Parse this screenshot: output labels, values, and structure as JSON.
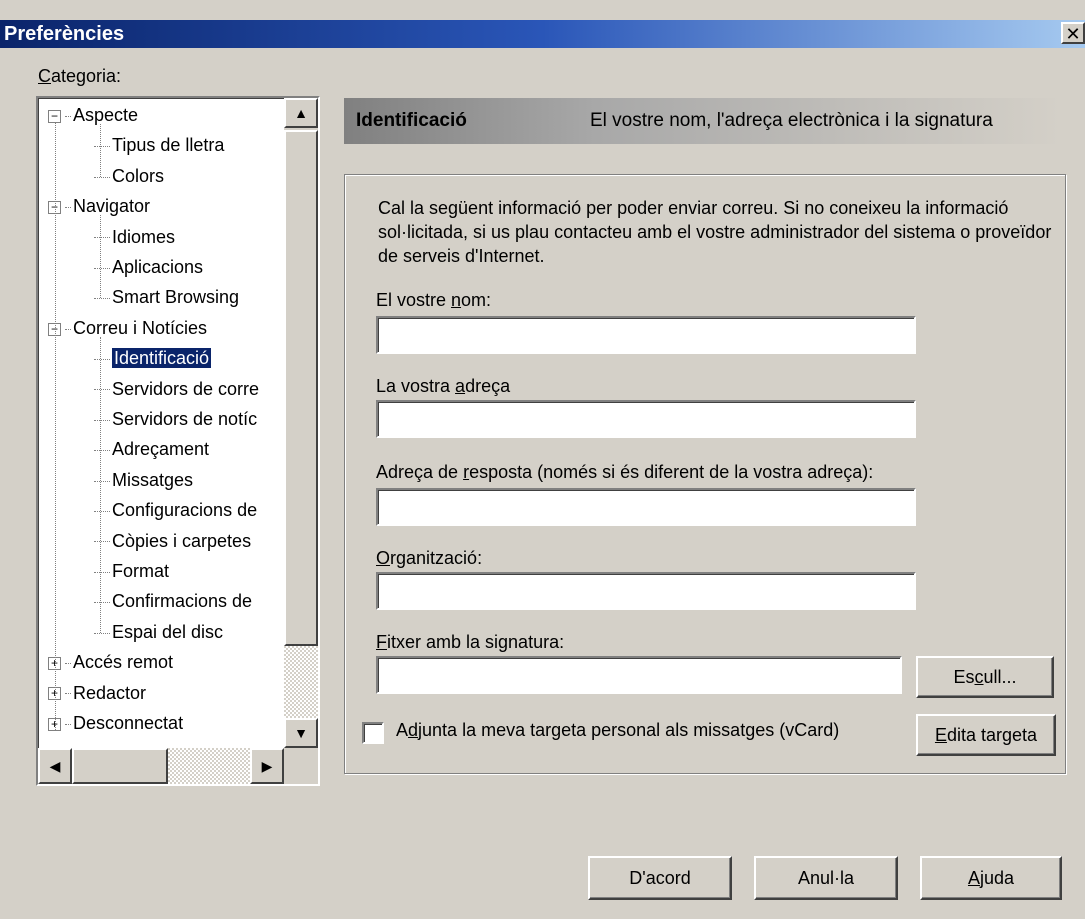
{
  "window": {
    "title": "Preferències",
    "close_glyph": "✕"
  },
  "category": {
    "label_pre": "",
    "label_ul": "C",
    "label_post": "ategoria:"
  },
  "tree": {
    "items": [
      {
        "label": "Aspecte",
        "level": 0,
        "expander": "−"
      },
      {
        "label": "Tipus de lletra",
        "level": 1
      },
      {
        "label": "Colors",
        "level": 1
      },
      {
        "label": "Navigator",
        "level": 0,
        "expander": "−"
      },
      {
        "label": "Idiomes",
        "level": 1
      },
      {
        "label": "Aplicacions",
        "level": 1
      },
      {
        "label": "Smart Browsing",
        "level": 1
      },
      {
        "label": "Correu i Notícies",
        "level": 0,
        "expander": "−"
      },
      {
        "label": "Identificació",
        "level": 1,
        "selected": true
      },
      {
        "label": "Servidors de corre",
        "level": 1
      },
      {
        "label": "Servidors de notíc",
        "level": 1
      },
      {
        "label": "Adreçament",
        "level": 1
      },
      {
        "label": "Missatges",
        "level": 1
      },
      {
        "label": "Configuracions de",
        "level": 1
      },
      {
        "label": "Còpies i carpetes",
        "level": 1
      },
      {
        "label": "Format",
        "level": 1
      },
      {
        "label": "Confirmacions de",
        "level": 1
      },
      {
        "label": "Espai del disc",
        "level": 1
      },
      {
        "label": "Accés remot",
        "level": 0,
        "expander": "+"
      },
      {
        "label": "Redactor",
        "level": 0,
        "expander": "+"
      },
      {
        "label": "Desconnectat",
        "level": 0,
        "expander": "+"
      }
    ]
  },
  "header": {
    "title": "Identificació",
    "description": "El vostre nom, l'adreça electrònica i  la signatura"
  },
  "intro": "Cal la següent informació per poder enviar correu.  Si no coneixeu la informació sol·licitada, si us plau contacteu amb el vostre administrador del sistema o proveïdor de serveis d'Internet.",
  "fields": {
    "name": {
      "pre": "El vostre ",
      "ul": "n",
      "post": "om:",
      "value": ""
    },
    "address": {
      "pre": "La vostra ",
      "ul": "a",
      "post": "dreça",
      "value": ""
    },
    "reply": {
      "pre": "Adreça de ",
      "ul": "r",
      "post": "esposta (només si és diferent de la vostra adreça):",
      "value": ""
    },
    "org": {
      "pre": "",
      "ul": "O",
      "post": "rganització:",
      "value": ""
    },
    "sigfile": {
      "pre": "",
      "ul": "F",
      "post": "itxer amb la signatura:",
      "value": ""
    }
  },
  "buttons": {
    "choose": {
      "pre": "Es",
      "ul": "c",
      "post": "ull..."
    },
    "edit_card": {
      "pre": "",
      "ul": "E",
      "post": "dita targeta"
    },
    "ok": "D'acord",
    "cancel": "Anul·la",
    "help": {
      "pre": "",
      "ul": "A",
      "post": "juda"
    }
  },
  "vcard": {
    "pre": "A",
    "ul": "d",
    "post": "junta la meva targeta personal als missatges (vCard)",
    "checked": false
  },
  "icons": {
    "up": "▲",
    "down": "▼",
    "left": "◀",
    "right": "▶"
  }
}
